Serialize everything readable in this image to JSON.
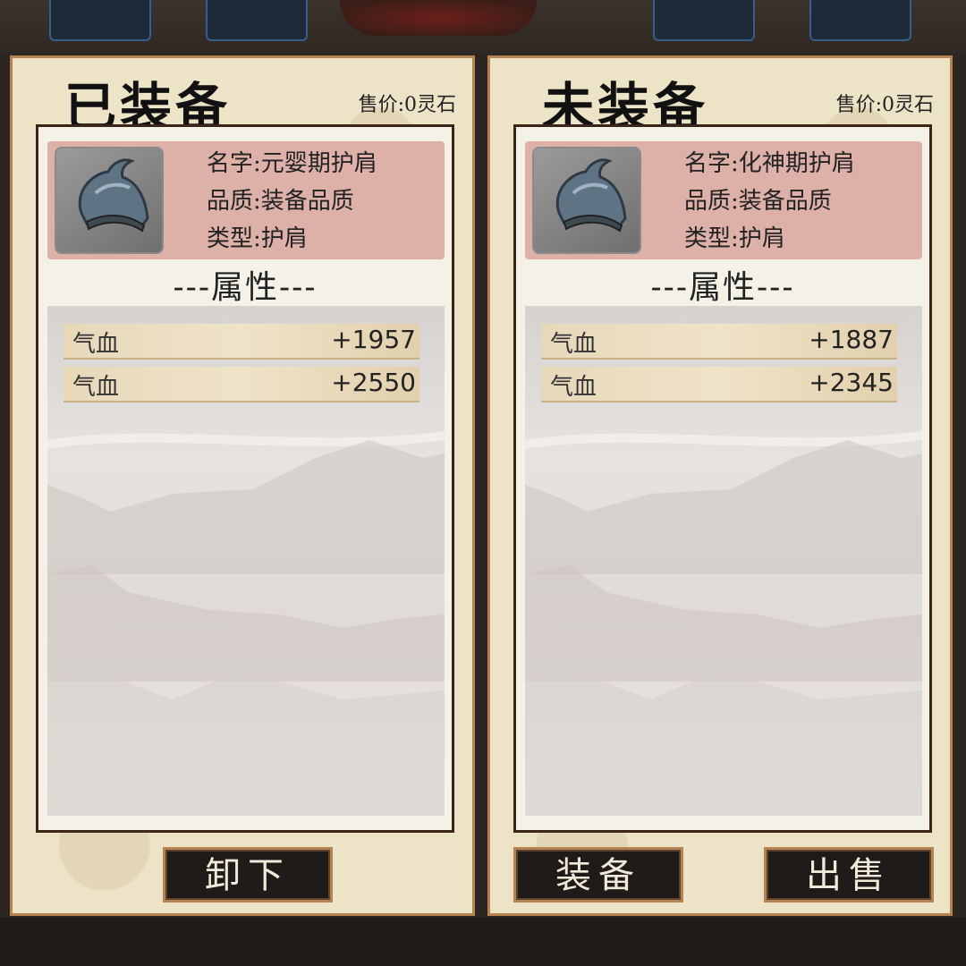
{
  "equipped": {
    "title": "已装备",
    "sell_price": "售价:0灵石",
    "item": {
      "icon": "shoulder-guard-icon",
      "name": "名字:元婴期护肩",
      "quality": "品质:装备品质",
      "type": "类型:护肩"
    },
    "attr_heading": "---属性---",
    "attributes": [
      {
        "name": "气血",
        "value": "+1957"
      },
      {
        "name": "气血",
        "value": "+2550"
      }
    ],
    "unequip_label": "卸下"
  },
  "unequipped": {
    "title": "未装备",
    "sell_price": "售价:0灵石",
    "item": {
      "icon": "shoulder-guard-icon",
      "name": "名字:化神期护肩",
      "quality": "品质:装备品质",
      "type": "类型:护肩"
    },
    "attr_heading": "---属性---",
    "attributes": [
      {
        "name": "气血",
        "value": "+1887"
      },
      {
        "name": "气血",
        "value": "+2345"
      }
    ],
    "equip_label": "装备",
    "sell_label": "出售"
  }
}
